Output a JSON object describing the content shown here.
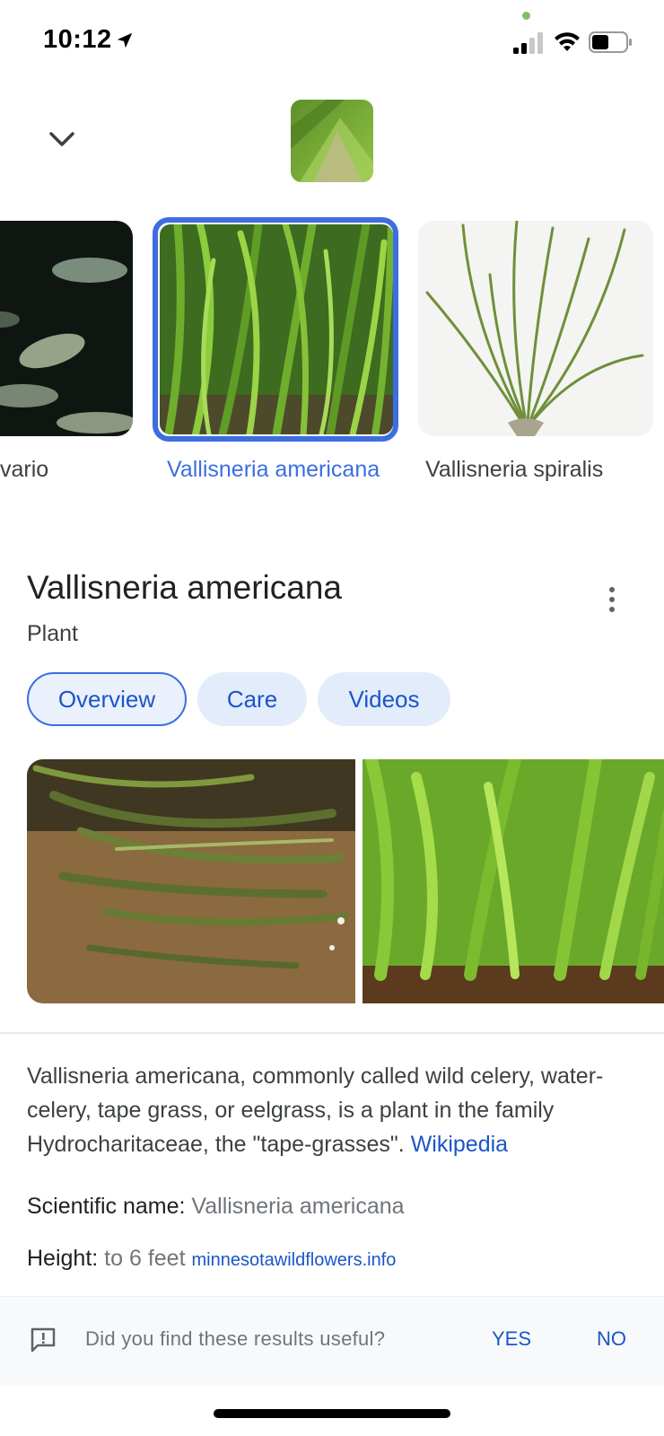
{
  "status_bar": {
    "time": "10:12",
    "location_icon": "location-arrow-icon",
    "signal_icon": "cellular-signal-icon",
    "wifi_icon": "wifi-icon",
    "battery_icon": "battery-icon"
  },
  "header": {
    "collapse_icon": "chevron-down-icon",
    "query_image": "query-thumbnail"
  },
  "carousel": {
    "items": [
      {
        "label": "vario",
        "image": "fish-photo"
      },
      {
        "label": "Vallisneria americana",
        "image": "vallisneria-americana-photo",
        "selected": true
      },
      {
        "label": "Vallisneria spiralis",
        "image": "vallisneria-spiralis-photo"
      }
    ]
  },
  "knowledge_panel": {
    "title": "Vallisneria americana",
    "subtitle": "Plant",
    "more_icon": "more-vert-icon",
    "tabs": [
      {
        "label": "Overview",
        "active": true
      },
      {
        "label": "Care",
        "active": false
      },
      {
        "label": "Videos",
        "active": false
      }
    ],
    "description": "Vallisneria americana, commonly called wild celery, water-celery, tape grass, or eelgrass, is a plant in the family Hydrocharitaceae, the \"tape-grasses\".",
    "description_source": "Wikipedia",
    "facts": [
      {
        "label": "Scientific name:",
        "value": "Vallisneria americana",
        "source": ""
      },
      {
        "label": "Height:",
        "value": "to 6 feet",
        "source": "minnesotawildflowers.info"
      }
    ]
  },
  "feedback": {
    "icon": "feedback-icon",
    "question": "Did you find these results useful?",
    "yes_label": "YES",
    "no_label": "NO"
  },
  "colors": {
    "accent": "#3c6ee0",
    "link": "#1a56c8",
    "chip_bg": "#e3ecfb"
  }
}
